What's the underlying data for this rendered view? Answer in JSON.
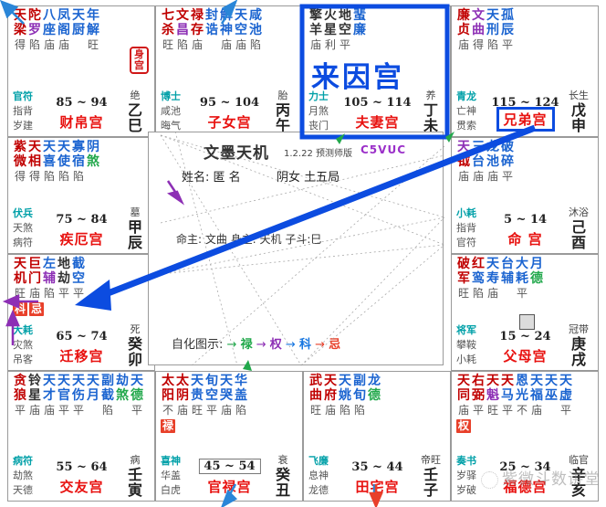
{
  "app": {
    "title": "文墨天机",
    "version": "1.2.22 预测师版",
    "code": "C5VUC",
    "watermark": "紫微斗数讲堂",
    "watermark_red_part": "斗数"
  },
  "center": {
    "name_label": "姓名:",
    "name_value": "匿 名",
    "sex_line": "阴女 土五局",
    "lord_line": "命主: 文曲 身主: 天机 子斗:巳",
    "legend_label": "自化图示:",
    "legend_items": [
      {
        "arrow": "→",
        "label": "禄",
        "color": "#21a84b"
      },
      {
        "arrow": "→",
        "label": "权",
        "color": "#8d2fb5"
      },
      {
        "arrow": "→",
        "label": "科",
        "color": "#1575e0"
      },
      {
        "arrow": "→",
        "label": "忌",
        "color": "#e8402a"
      }
    ]
  },
  "badges": {
    "shen_gong": [
      "身",
      "宫"
    ],
    "lai_yin_gong": "来因宫"
  },
  "palaces": [
    {
      "id": "cell-caibo",
      "pos": "r0c0",
      "stars_top": [
        "天",
        "陀",
        "八",
        "凤",
        "天",
        "年"
      ],
      "stars_bottom": [
        "梁",
        "罗",
        "座",
        "阁",
        "厨",
        "解"
      ],
      "brightness": [
        "得",
        "陷",
        "庙",
        "庙",
        "",
        "旺"
      ],
      "star_colors_top": [
        "#c00000",
        "#c00000",
        "#1b64d0",
        "#1b64d0",
        "#1b64d0",
        "#1b64d0"
      ],
      "star_colors_bottom": [
        "#c00000",
        "#8d2fb5",
        "#1b64d0",
        "#1b64d0",
        "#1b64d0",
        "#1b64d0"
      ],
      "hua": [],
      "n1": "官符",
      "n2": "指背",
      "n3": "岁建",
      "age": "85 ~ 94",
      "age_boxed": false,
      "stage": "绝",
      "stem": "乙",
      "branch": "巳",
      "palace_name": "财帛宫",
      "highlight": false
    },
    {
      "id": "cell-zinv",
      "pos": "r0c1",
      "stars_top": [
        "七",
        "文",
        "禄",
        "封",
        "解",
        "天",
        "咸"
      ],
      "stars_bottom": [
        "杀",
        "昌",
        "存",
        "诰",
        "神",
        "空",
        "池"
      ],
      "brightness": [
        "旺",
        "陷",
        "庙",
        "",
        "庙",
        "庙",
        "陷"
      ],
      "star_colors_top": [
        "#c00000",
        "#c00000",
        "#c00000",
        "#1b64d0",
        "#1b64d0",
        "#1b64d0",
        "#1b64d0"
      ],
      "star_colors_bottom": [
        "#c00000",
        "#8d2fb5",
        "#c00000",
        "#1b64d0",
        "#1b64d0",
        "#1b64d0",
        "#1b64d0"
      ],
      "hua": [],
      "n1": "博士",
      "n2": "咸池",
      "n3": "晦气",
      "age": "95 ~ 104",
      "age_boxed": false,
      "stage": "胎",
      "stem": "丙",
      "branch": "午",
      "palace_name": "子女宫",
      "highlight": false
    },
    {
      "id": "cell-fuqi",
      "pos": "r0c2",
      "stars_top": [
        "擎",
        "火",
        "地",
        "蜚"
      ],
      "stars_bottom": [
        "羊",
        "星",
        "空",
        "廉"
      ],
      "brightness": [
        "庙",
        "利",
        "平",
        ""
      ],
      "star_colors_top": [
        "#333333",
        "#333333",
        "#333333",
        "#1b64d0"
      ],
      "star_colors_bottom": [
        "#333333",
        "#333333",
        "#333333",
        "#1b64d0"
      ],
      "hua": [],
      "n1": "力士",
      "n2": "月煞",
      "n3": "丧门",
      "age": "105 ~ 114",
      "age_boxed": false,
      "stage": "养",
      "stem": "丁",
      "branch": "未",
      "palace_name": "夫妻宫",
      "highlight": false
    },
    {
      "id": "cell-xiongdi",
      "pos": "r0c3",
      "stars_top": [
        "廉",
        "文",
        "天",
        "孤"
      ],
      "stars_bottom": [
        "贞",
        "曲",
        "刑",
        "辰"
      ],
      "brightness": [
        "庙",
        "得",
        "陷",
        "平"
      ],
      "star_colors_top": [
        "#c00000",
        "#8d2fb5",
        "#1b64d0",
        "#1b64d0"
      ],
      "star_colors_bottom": [
        "#c00000",
        "#8d2fb5",
        "#1b64d0",
        "#1b64d0"
      ],
      "hua": [],
      "n1": "青龙",
      "n2": "亡神",
      "n3": "贯索",
      "age": "115 ~ 124",
      "age_boxed": false,
      "stage": "长生",
      "stem": "戊",
      "branch": "申",
      "palace_name": "兄弟宫",
      "highlight": true
    },
    {
      "id": "cell-jie",
      "pos": "r1c0",
      "stars_top": [
        "紫",
        "天",
        "天",
        "天",
        "寡",
        "阴"
      ],
      "stars_bottom": [
        "微",
        "相",
        "喜",
        "使",
        "宿",
        "煞"
      ],
      "brightness": [
        "得",
        "得",
        "陷",
        "陷",
        "陷",
        ""
      ],
      "star_colors_top": [
        "#c00000",
        "#c00000",
        "#1b64d0",
        "#1b64d0",
        "#1b64d0",
        "#1b64d0"
      ],
      "star_colors_bottom": [
        "#c00000",
        "#c00000",
        "#1b64d0",
        "#1b64d0",
        "#1b64d0",
        "#21a84b"
      ],
      "hua": [],
      "n1": "伏兵",
      "n2": "天煞",
      "n3": "病符",
      "age": "75 ~ 84",
      "age_boxed": false,
      "stage": "墓",
      "stem": "甲",
      "branch": "辰",
      "palace_name": "疾厄宫",
      "highlight": false
    },
    {
      "id": "cell-qianyi",
      "pos": "r2c0",
      "stars_top": [
        "天",
        "巨",
        "左",
        "地",
        "截"
      ],
      "stars_bottom": [
        "机",
        "门",
        "辅",
        "劫",
        "空"
      ],
      "brightness": [
        "旺",
        "庙",
        "陷",
        "平",
        "平"
      ],
      "star_colors_top": [
        "#c00000",
        "#c00000",
        "#1b64d0",
        "#333333",
        "#1b64d0"
      ],
      "star_colors_bottom": [
        "#c00000",
        "#c00000",
        "#8d2fb5",
        "#333333",
        "#1b64d0"
      ],
      "hua": [
        "科",
        "忌"
      ],
      "n1": "大耗",
      "n2": "灾煞",
      "n3": "吊客",
      "age": "65 ~ 74",
      "age_boxed": false,
      "stage": "死",
      "stem": "癸",
      "branch": "卯",
      "palace_name": "迁移宫",
      "highlight": false
    },
    {
      "id": "cell-jiaoyou",
      "pos": "r3c0",
      "stars_top": [
        "贪",
        "铃",
        "天",
        "天",
        "天",
        "天",
        "副",
        "劫",
        "天"
      ],
      "stars_bottom": [
        "狼",
        "星",
        "才",
        "官",
        "伤",
        "月",
        "截",
        "煞",
        "德"
      ],
      "brightness": [
        "平",
        "庙",
        "庙",
        "平",
        "平",
        "",
        "陷",
        "",
        "平"
      ],
      "star_colors_top": [
        "#c00000",
        "#333333",
        "#1b64d0",
        "#1b64d0",
        "#1b64d0",
        "#1b64d0",
        "#1b64d0",
        "#1b64d0",
        "#1b64d0"
      ],
      "star_colors_bottom": [
        "#c00000",
        "#333333",
        "#1b64d0",
        "#1b64d0",
        "#1b64d0",
        "#1b64d0",
        "#1b64d0",
        "#21a84b",
        "#21a84b"
      ],
      "hua": [],
      "n1": "病符",
      "n2": "劫煞",
      "n3": "天德",
      "age": "55 ~ 64",
      "age_boxed": false,
      "stage": "病",
      "stem": "壬",
      "branch": "寅",
      "palace_name": "交友宫",
      "highlight": false
    },
    {
      "id": "cell-guanlu",
      "pos": "r3c1",
      "stars_top": [
        "太",
        "太",
        "天",
        "旬",
        "天",
        "华"
      ],
      "stars_bottom": [
        "阳",
        "阴",
        "贵",
        "空",
        "哭",
        "盖"
      ],
      "brightness": [
        "不",
        "庙",
        "旺",
        "平",
        "庙",
        "陷"
      ],
      "star_colors_top": [
        "#c00000",
        "#c00000",
        "#1b64d0",
        "#1b64d0",
        "#1b64d0",
        "#1b64d0"
      ],
      "star_colors_bottom": [
        "#c00000",
        "#c00000",
        "#1b64d0",
        "#1b64d0",
        "#1b64d0",
        "#1b64d0"
      ],
      "hua": [
        "禄"
      ],
      "n1": "喜神",
      "n2": "华盖",
      "n3": "白虎",
      "age": "45 ~ 54",
      "age_boxed": true,
      "stage": "衰",
      "stem": "癸",
      "branch": "丑",
      "palace_name": "官禄宫",
      "highlight": false
    },
    {
      "id": "cell-tianzhai",
      "pos": "r3c2",
      "stars_top": [
        "武",
        "天",
        "天",
        "副",
        "龙"
      ],
      "stars_bottom": [
        "曲",
        "府",
        "姚",
        "旬",
        "德"
      ],
      "brightness": [
        "旺",
        "庙",
        "陷",
        "陷",
        ""
      ],
      "star_colors_top": [
        "#c00000",
        "#c00000",
        "#1b64d0",
        "#1b64d0",
        "#1b64d0"
      ],
      "star_colors_bottom": [
        "#c00000",
        "#c00000",
        "#1b64d0",
        "#1b64d0",
        "#21a84b"
      ],
      "hua": [],
      "n1": "飞廉",
      "n2": "息神",
      "n3": "龙德",
      "age": "35 ~ 44",
      "age_boxed": false,
      "stage": "帝旺",
      "stem": "壬",
      "branch": "子",
      "palace_name": "田宅宫",
      "highlight": false
    },
    {
      "id": "cell-fumu-bottom",
      "pos": "r3c3",
      "stars_top": [
        "天",
        "右",
        "天",
        "天",
        "恩",
        "天",
        "天",
        "天"
      ],
      "stars_bottom": [
        "同",
        "弼",
        "魁",
        "马",
        "光",
        "福",
        "巫",
        "虚"
      ],
      "brightness": [
        "庙",
        "平",
        "旺",
        "平",
        "不",
        "庙",
        "",
        "平"
      ],
      "star_colors_top": [
        "#c00000",
        "#c00000",
        "#c00000",
        "#c00000",
        "#1b64d0",
        "#1b64d0",
        "#1b64d0",
        "#1b64d0"
      ],
      "star_colors_bottom": [
        "#c00000",
        "#c00000",
        "#8d2fb5",
        "#1b64d0",
        "#1b64d0",
        "#1b64d0",
        "#1b64d0",
        "#1b64d0"
      ],
      "hua": [
        "权"
      ],
      "n1": "奏书",
      "n2": "岁驿",
      "n3": "岁破",
      "age": "25 ~ 34",
      "age_boxed": false,
      "stage": "临官",
      "stem": "辛",
      "branch": "亥",
      "palace_name": "福德宫",
      "highlight": false
    },
    {
      "id": "cell-fumu",
      "pos": "r2c3",
      "stars_top": [
        "破",
        "红",
        "天",
        "台",
        "大",
        "月"
      ],
      "stars_bottom": [
        "军",
        "鸾",
        "寿",
        "辅",
        "耗",
        "德"
      ],
      "brightness": [
        "旺",
        "陷",
        "庙",
        "",
        "平",
        ""
      ],
      "star_colors_top": [
        "#c00000",
        "#c00000",
        "#1b64d0",
        "#1b64d0",
        "#1b64d0",
        "#1b64d0"
      ],
      "star_colors_bottom": [
        "#c00000",
        "#1b64d0",
        "#1b64d0",
        "#1b64d0",
        "#1b64d0",
        "#21a84b"
      ],
      "hua": [],
      "n1": "将军",
      "n2": "攀鞍",
      "n3": "小耗",
      "age": "15 ~ 24",
      "age_boxed": false,
      "stage": "冠带",
      "stem": "庚",
      "branch": "戌",
      "palace_name": "父母宫",
      "highlight": false
    },
    {
      "id": "cell-ming",
      "pos": "r1c3",
      "stars_top": [
        "天",
        "三",
        "龙",
        "破"
      ],
      "stars_bottom": [
        "钺",
        "台",
        "池",
        "碎"
      ],
      "brightness": [
        "庙",
        "庙",
        "庙",
        "平"
      ],
      "star_colors_top": [
        "#8d2fb5",
        "#1b64d0",
        "#1b64d0",
        "#1b64d0"
      ],
      "star_colors_bottom": [
        "#c00000",
        "#1b64d0",
        "#1b64d0",
        "#1b64d0"
      ],
      "hua": [],
      "n1": "小耗",
      "n2": "指背",
      "n3": "官符",
      "age": "5 ~ 14",
      "age_boxed": false,
      "stage": "沐浴",
      "stem": "己",
      "branch": "酉",
      "palace_name": "命 宫",
      "highlight": false
    }
  ]
}
